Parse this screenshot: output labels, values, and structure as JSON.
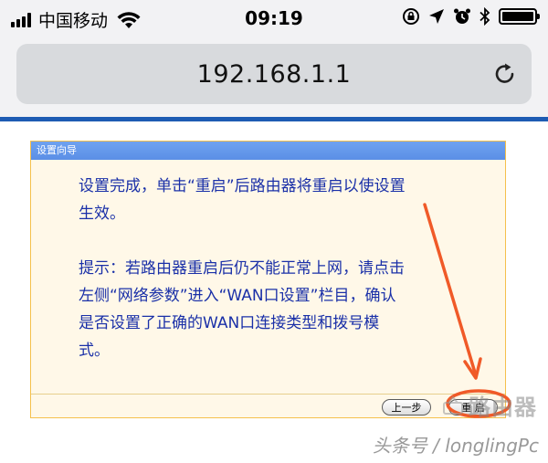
{
  "status_bar": {
    "carrier": "中国移动",
    "time": "09:19",
    "icons": [
      "signal-bars-icon",
      "wifi-icon",
      "orientation-lock-icon",
      "location-icon",
      "alarm-icon",
      "bluetooth-icon",
      "battery-icon"
    ]
  },
  "browser": {
    "url": "192.168.1.1",
    "reload_icon": "reload-icon"
  },
  "dialog": {
    "title": "设置向导",
    "message_line1": "设置完成，单击“重启”后路由器将重启以使设置",
    "message_line2": "生效。",
    "hint_line1": "提示：若路由器重启后仍不能正常上网，请点击",
    "hint_line2": "左侧“网络参数”进入“WAN口设置”栏目，确认",
    "hint_line3": "是否设置了正确的WAN口连接类型和拨号模",
    "hint_line4": "式。",
    "buttons": {
      "prev": "上一步",
      "reboot": "重 启"
    }
  },
  "annotation": {
    "color": "#f05a28"
  },
  "watermark": {
    "brand": "路由器",
    "credit": "头条号 / longlingPc"
  }
}
